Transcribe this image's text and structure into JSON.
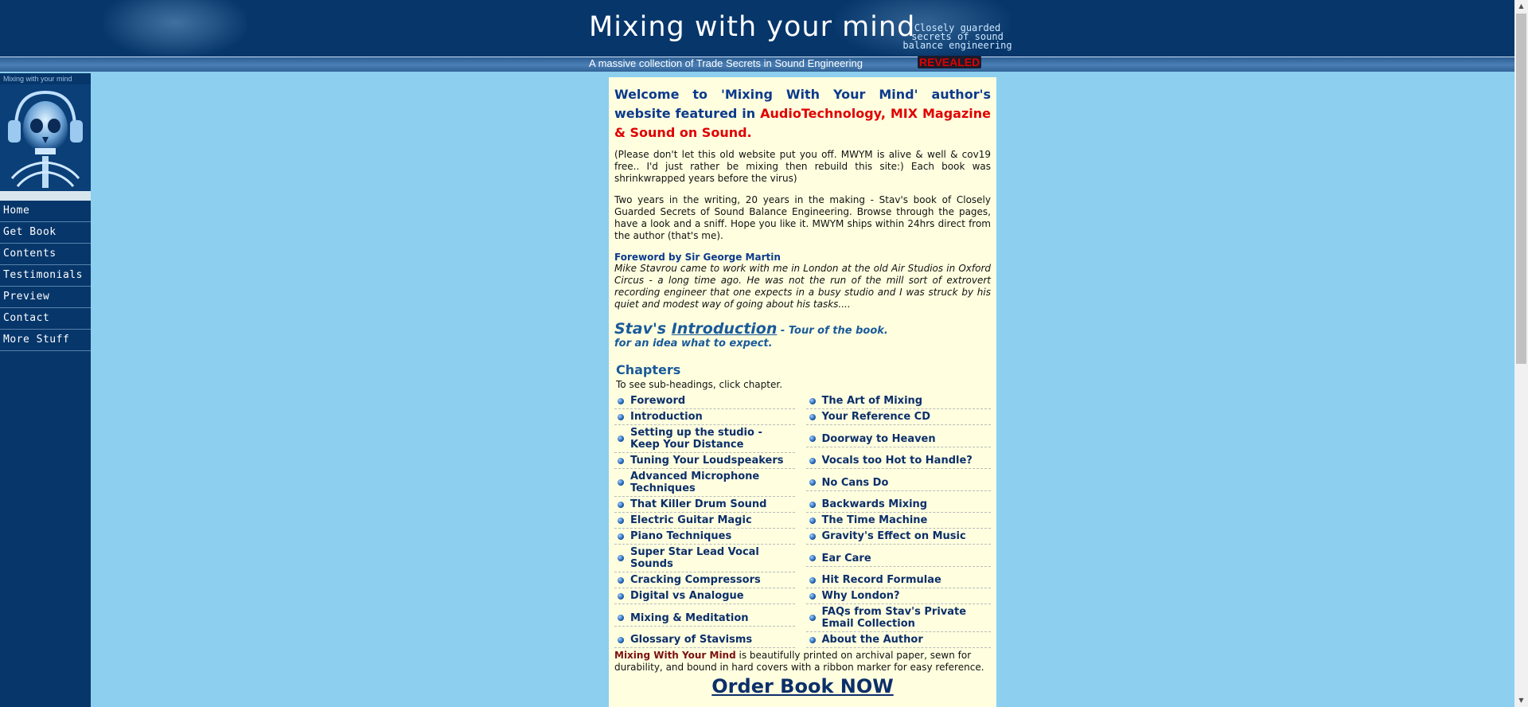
{
  "header": {
    "title": "Mixing with your mind",
    "secrets_line1": "Closely guarded",
    "secrets_line2": "secrets of sound",
    "secrets_line3": "balance engineering",
    "tagline": "A massive collection of Trade Secrets in Sound Engineering",
    "revealed": "REVEALED"
  },
  "sidebar": {
    "caption": "Mixing with your mind",
    "items": [
      {
        "label": "Home"
      },
      {
        "label": "Get Book"
      },
      {
        "label": "Contents"
      },
      {
        "label": "Testimonials"
      },
      {
        "label": "Preview"
      },
      {
        "label": "Contact"
      },
      {
        "label": "More Stuff"
      }
    ]
  },
  "main": {
    "welcome_part1": "Welcome to 'Mixing With Your Mind' author's website featured in ",
    "welcome_part2": "AudioTechnology, MIX Magazine & Sound on Sound.",
    "para1": "(Please don't let this old website put you off. MWYM is alive & well & cov19 free.. I'd just rather be mixing then rebuild this site:) Each book was shrinkwrapped years before the virus)",
    "para2": "Two years in the writing, 20 years in the making - Stav's book of Closely Guarded Secrets of Sound Balance Engineering. Browse through the pages, have a look and a sniff. Hope you like it. MWYM ships within 24hrs direct from the author (that's me).",
    "foreword_heading": "Foreword by Sir George Martin",
    "foreword_quote": "Mike Stavrou came to work with me in London at the old Air Studios in Oxford Circus - a long time ago. He was not the run of the mill sort of extrovert recording engineer that one expects in a busy studio and I was struck by his quiet and modest way of going about his tasks....",
    "intro_prefix": "Stav's ",
    "intro_link": "Introduction",
    "intro_suffix": " - Tour of the book.",
    "intro_sub": "for an idea what to expect.",
    "chapters_heading": "Chapters",
    "chapters_note": "To see sub-headings, click chapter.",
    "chapters": [
      [
        "Foreword",
        "The Art of Mixing"
      ],
      [
        "Introduction",
        "Your Reference CD"
      ],
      [
        "Setting up the studio - Keep Your Distance",
        "Doorway to Heaven"
      ],
      [
        "Tuning Your Loudspeakers",
        "Vocals too Hot to Handle?"
      ],
      [
        "Advanced Microphone Techniques",
        "No Cans Do"
      ],
      [
        "That Killer Drum Sound",
        "Backwards Mixing"
      ],
      [
        "Electric Guitar Magic",
        "The Time Machine"
      ],
      [
        "Piano Techniques",
        "Gravity's Effect on Music"
      ],
      [
        "Super Star Lead Vocal Sounds",
        "Ear Care"
      ],
      [
        "Cracking Compressors",
        "Hit Record Formulae"
      ],
      [
        "Digital vs Analogue",
        "Why London?"
      ],
      [
        "Mixing & Meditation",
        "FAQs from Stav's Private Email Collection"
      ],
      [
        "Glossary of Stavisms",
        "About the Author"
      ]
    ],
    "closing_brand": "Mixing With Your Mind",
    "closing_text": " is beautifully printed on archival paper, sewn for durability, and bound in hard covers with a ribbon marker for easy reference.",
    "order_label": "Order Book NOW"
  },
  "colors": {
    "page_background": "#8ccfee",
    "header_background": "#06366a",
    "content_background": "#ffffe0",
    "accent_red": "#e00000",
    "heading_blue": "#0c3a8c"
  }
}
